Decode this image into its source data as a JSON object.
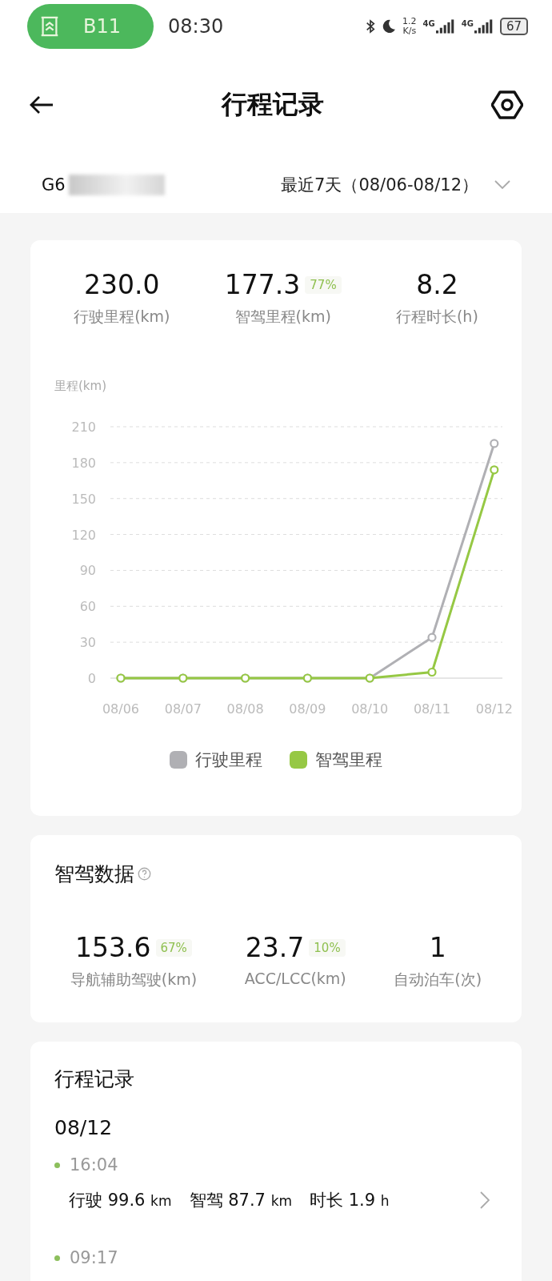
{
  "status_bar": {
    "pill_label": "B11",
    "time": "08:30",
    "speed_value": "1.2",
    "speed_unit": "K/s",
    "sim_1": "4G",
    "sim_2": "4G",
    "battery": "67"
  },
  "header": {
    "title": "行程记录"
  },
  "filter": {
    "vehicle": "G6",
    "period": "最近7天（08/06-08/12）"
  },
  "summary": {
    "stats": [
      {
        "value": "230.0",
        "label": "行驶里程(km)"
      },
      {
        "value": "177.3",
        "badge": "77%",
        "label": "智驾里程(km)"
      },
      {
        "value": "8.2",
        "label": "行程时长(h)"
      }
    ],
    "chart_data": {
      "type": "line",
      "grid": true,
      "ylabel": "里程(km)",
      "categories": [
        "08/06",
        "08/07",
        "08/08",
        "08/09",
        "08/10",
        "08/11",
        "08/12"
      ],
      "ylim": [
        0,
        210
      ],
      "yticks": [
        0,
        30,
        60,
        90,
        120,
        150,
        180,
        210
      ],
      "series": [
        {
          "name": "行驶里程",
          "color": "#b0b0b4",
          "marker": true,
          "values": [
            0,
            0,
            0,
            0,
            0,
            34,
            196
          ]
        },
        {
          "name": "智驾里程",
          "color": "#96c844",
          "marker": true,
          "values": [
            0,
            0,
            0,
            0,
            0,
            5,
            174
          ]
        }
      ]
    }
  },
  "assist": {
    "title": "智驾数据",
    "stats": [
      {
        "value": "153.6",
        "badge": "67%",
        "label": "导航辅助驾驶(km)"
      },
      {
        "value": "23.7",
        "badge": "10%",
        "label": "ACC/LCC(km)"
      },
      {
        "value": "1",
        "label": "自动泊车(次)"
      }
    ]
  },
  "trips": {
    "title": "行程记录",
    "days": [
      {
        "date": "08/12",
        "trips": [
          {
            "time": "16:04",
            "metrics": [
              {
                "label": "行驶",
                "value": "99.6",
                "unit": "km"
              },
              {
                "label": "智驾",
                "value": "87.7",
                "unit": "km"
              },
              {
                "label": "时长",
                "value": "1.9",
                "unit": "h"
              }
            ]
          },
          {
            "time": "09:17"
          }
        ]
      }
    ]
  }
}
